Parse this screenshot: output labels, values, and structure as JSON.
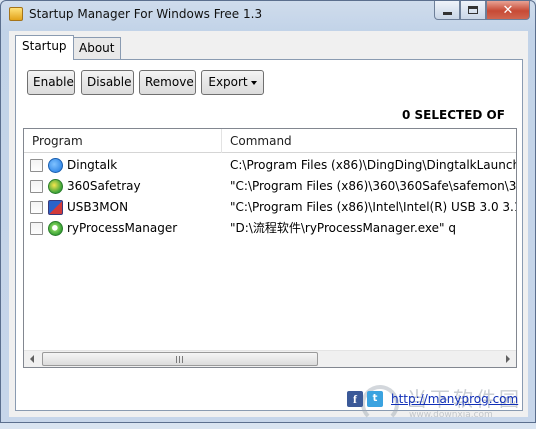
{
  "window": {
    "title": "Startup Manager For Windows Free 1.3",
    "controls": {
      "minimize": "minimize",
      "maximize": "maximize",
      "close": "✕"
    }
  },
  "tabs": [
    {
      "label": "Startup",
      "active": true
    },
    {
      "label": "About",
      "active": false
    }
  ],
  "toolbar": {
    "enable_label": "Enable",
    "disable_label": "Disable",
    "remove_label": "Remove",
    "export_label": "Export"
  },
  "selection_status": "0 SELECTED OF",
  "list": {
    "columns": [
      "Program",
      "Command"
    ],
    "rows": [
      {
        "program": "Dingtalk",
        "command": "C:\\Program Files (x86)\\DingDing\\DingtalkLaunch",
        "icon": "dingtalk-icon",
        "checked": false
      },
      {
        "program": "360Safetray",
        "command": "\"C:\\Program Files (x86)\\360\\360Safe\\safemon\\36",
        "icon": "360-shield-icon",
        "checked": false
      },
      {
        "program": "USB3MON",
        "command": "\"C:\\Program Files (x86)\\Intel\\Intel(R) USB 3.0 3.1",
        "icon": "usb-monitor-icon",
        "checked": false
      },
      {
        "program": "ryProcessManager",
        "command": "\"D:\\流程软件\\ryProcessManager.exe\" q",
        "icon": "process-manager-icon",
        "checked": false
      }
    ],
    "scrollbar_grip": "III"
  },
  "footer": {
    "facebook_glyph": "f",
    "twitter_glyph": "t",
    "link": "http://manyprog.com"
  },
  "watermark": {
    "title": "当下软件园",
    "url": "www.downxia.com"
  },
  "colors": {
    "titlebar": "#c7d6ea",
    "close_button": "#c74a35",
    "link": "#1230b8"
  }
}
